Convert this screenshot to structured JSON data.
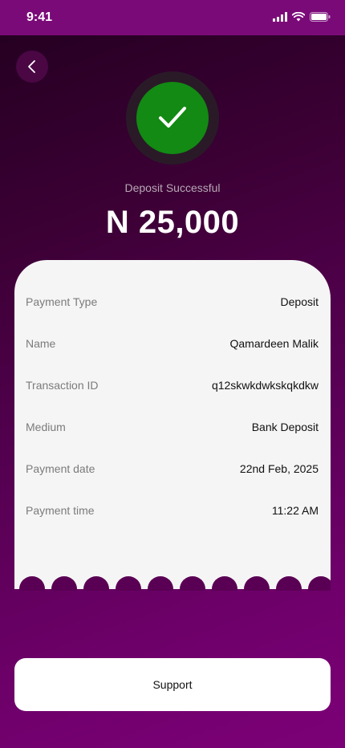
{
  "status_bar": {
    "time": "9:41"
  },
  "header": {
    "status_text": "Deposit Successful",
    "amount": "N 25,000"
  },
  "details": [
    {
      "label": "Payment Type",
      "value": "Deposit"
    },
    {
      "label": "Name",
      "value": "Qamardeen Malik"
    },
    {
      "label": "Transaction ID",
      "value": "q12skwkdwkskqkdkw"
    },
    {
      "label": "Medium",
      "value": "Bank Deposit"
    },
    {
      "label": "Payment date",
      "value": "22nd Feb, 2025"
    },
    {
      "label": "Payment time",
      "value": "11:22 AM"
    }
  ],
  "footer": {
    "support_label": "Support"
  },
  "colors": {
    "success": "#128a13",
    "brand": "#7b0a79",
    "card": "#f5f5f5"
  },
  "icons": [
    "back-icon",
    "checkmark-icon",
    "signal-icon",
    "wifi-icon",
    "battery-icon"
  ]
}
